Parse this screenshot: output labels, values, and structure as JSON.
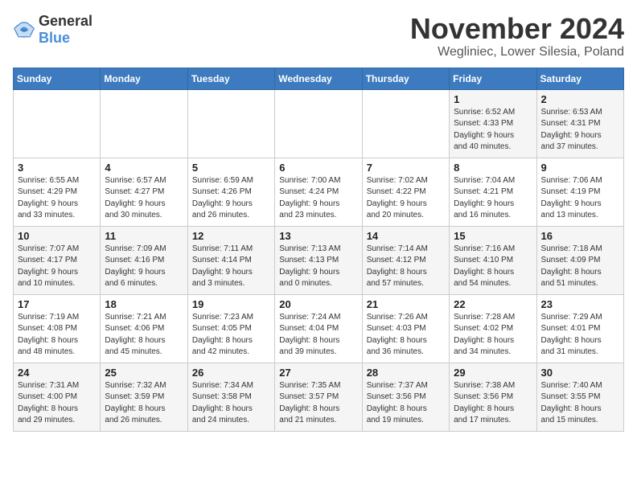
{
  "logo": {
    "general": "General",
    "blue": "Blue"
  },
  "title": "November 2024",
  "location": "Wegliniec, Lower Silesia, Poland",
  "weekdays": [
    "Sunday",
    "Monday",
    "Tuesday",
    "Wednesday",
    "Thursday",
    "Friday",
    "Saturday"
  ],
  "weeks": [
    [
      {
        "day": "",
        "info": ""
      },
      {
        "day": "",
        "info": ""
      },
      {
        "day": "",
        "info": ""
      },
      {
        "day": "",
        "info": ""
      },
      {
        "day": "",
        "info": ""
      },
      {
        "day": "1",
        "info": "Sunrise: 6:52 AM\nSunset: 4:33 PM\nDaylight: 9 hours\nand 40 minutes."
      },
      {
        "day": "2",
        "info": "Sunrise: 6:53 AM\nSunset: 4:31 PM\nDaylight: 9 hours\nand 37 minutes."
      }
    ],
    [
      {
        "day": "3",
        "info": "Sunrise: 6:55 AM\nSunset: 4:29 PM\nDaylight: 9 hours\nand 33 minutes."
      },
      {
        "day": "4",
        "info": "Sunrise: 6:57 AM\nSunset: 4:27 PM\nDaylight: 9 hours\nand 30 minutes."
      },
      {
        "day": "5",
        "info": "Sunrise: 6:59 AM\nSunset: 4:26 PM\nDaylight: 9 hours\nand 26 minutes."
      },
      {
        "day": "6",
        "info": "Sunrise: 7:00 AM\nSunset: 4:24 PM\nDaylight: 9 hours\nand 23 minutes."
      },
      {
        "day": "7",
        "info": "Sunrise: 7:02 AM\nSunset: 4:22 PM\nDaylight: 9 hours\nand 20 minutes."
      },
      {
        "day": "8",
        "info": "Sunrise: 7:04 AM\nSunset: 4:21 PM\nDaylight: 9 hours\nand 16 minutes."
      },
      {
        "day": "9",
        "info": "Sunrise: 7:06 AM\nSunset: 4:19 PM\nDaylight: 9 hours\nand 13 minutes."
      }
    ],
    [
      {
        "day": "10",
        "info": "Sunrise: 7:07 AM\nSunset: 4:17 PM\nDaylight: 9 hours\nand 10 minutes."
      },
      {
        "day": "11",
        "info": "Sunrise: 7:09 AM\nSunset: 4:16 PM\nDaylight: 9 hours\nand 6 minutes."
      },
      {
        "day": "12",
        "info": "Sunrise: 7:11 AM\nSunset: 4:14 PM\nDaylight: 9 hours\nand 3 minutes."
      },
      {
        "day": "13",
        "info": "Sunrise: 7:13 AM\nSunset: 4:13 PM\nDaylight: 9 hours\nand 0 minutes."
      },
      {
        "day": "14",
        "info": "Sunrise: 7:14 AM\nSunset: 4:12 PM\nDaylight: 8 hours\nand 57 minutes."
      },
      {
        "day": "15",
        "info": "Sunrise: 7:16 AM\nSunset: 4:10 PM\nDaylight: 8 hours\nand 54 minutes."
      },
      {
        "day": "16",
        "info": "Sunrise: 7:18 AM\nSunset: 4:09 PM\nDaylight: 8 hours\nand 51 minutes."
      }
    ],
    [
      {
        "day": "17",
        "info": "Sunrise: 7:19 AM\nSunset: 4:08 PM\nDaylight: 8 hours\nand 48 minutes."
      },
      {
        "day": "18",
        "info": "Sunrise: 7:21 AM\nSunset: 4:06 PM\nDaylight: 8 hours\nand 45 minutes."
      },
      {
        "day": "19",
        "info": "Sunrise: 7:23 AM\nSunset: 4:05 PM\nDaylight: 8 hours\nand 42 minutes."
      },
      {
        "day": "20",
        "info": "Sunrise: 7:24 AM\nSunset: 4:04 PM\nDaylight: 8 hours\nand 39 minutes."
      },
      {
        "day": "21",
        "info": "Sunrise: 7:26 AM\nSunset: 4:03 PM\nDaylight: 8 hours\nand 36 minutes."
      },
      {
        "day": "22",
        "info": "Sunrise: 7:28 AM\nSunset: 4:02 PM\nDaylight: 8 hours\nand 34 minutes."
      },
      {
        "day": "23",
        "info": "Sunrise: 7:29 AM\nSunset: 4:01 PM\nDaylight: 8 hours\nand 31 minutes."
      }
    ],
    [
      {
        "day": "24",
        "info": "Sunrise: 7:31 AM\nSunset: 4:00 PM\nDaylight: 8 hours\nand 29 minutes."
      },
      {
        "day": "25",
        "info": "Sunrise: 7:32 AM\nSunset: 3:59 PM\nDaylight: 8 hours\nand 26 minutes."
      },
      {
        "day": "26",
        "info": "Sunrise: 7:34 AM\nSunset: 3:58 PM\nDaylight: 8 hours\nand 24 minutes."
      },
      {
        "day": "27",
        "info": "Sunrise: 7:35 AM\nSunset: 3:57 PM\nDaylight: 8 hours\nand 21 minutes."
      },
      {
        "day": "28",
        "info": "Sunrise: 7:37 AM\nSunset: 3:56 PM\nDaylight: 8 hours\nand 19 minutes."
      },
      {
        "day": "29",
        "info": "Sunrise: 7:38 AM\nSunset: 3:56 PM\nDaylight: 8 hours\nand 17 minutes."
      },
      {
        "day": "30",
        "info": "Sunrise: 7:40 AM\nSunset: 3:55 PM\nDaylight: 8 hours\nand 15 minutes."
      }
    ]
  ]
}
